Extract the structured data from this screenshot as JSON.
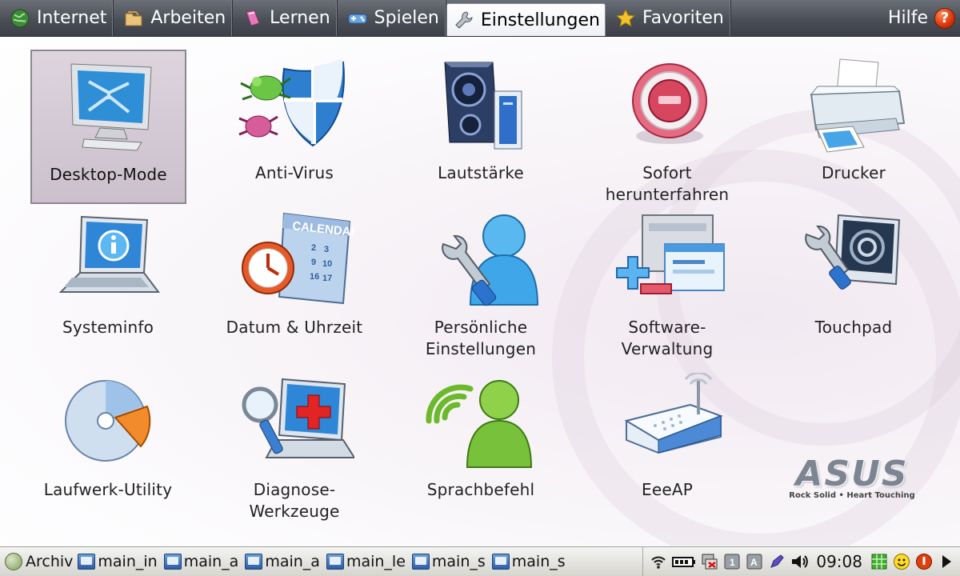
{
  "tabs": [
    {
      "name": "tab-internet",
      "icon": "globe-icon",
      "label": "Internet"
    },
    {
      "name": "tab-arbeiten",
      "icon": "folder-icon",
      "label": "Arbeiten"
    },
    {
      "name": "tab-lernen",
      "icon": "book-icon",
      "label": "Lernen"
    },
    {
      "name": "tab-spielen",
      "icon": "gamepad-icon",
      "label": "Spielen"
    },
    {
      "name": "tab-einstellungen",
      "icon": "wrench-icon",
      "label": "Einstellungen",
      "active": true
    },
    {
      "name": "tab-favoriten",
      "icon": "star-icon",
      "label": "Favoriten"
    }
  ],
  "help": {
    "label": "Hilfe",
    "icon": "help-icon",
    "glyph": "?"
  },
  "items": [
    {
      "name": "desktop-mode",
      "icon": "monitor-icon",
      "label": "Desktop-Mode",
      "selected": true
    },
    {
      "name": "anti-virus",
      "icon": "shield-bug-icon",
      "label": "Anti-Virus"
    },
    {
      "name": "lautstaerke",
      "icon": "speaker-icon",
      "label": "Lautstärke"
    },
    {
      "name": "sofort-herunterfahren",
      "icon": "power-button-icon",
      "label_lines": [
        "Sofort",
        "herunterfahren"
      ]
    },
    {
      "name": "drucker",
      "icon": "printer-icon",
      "label": "Drucker"
    },
    {
      "name": "systeminfo",
      "icon": "laptop-info-icon",
      "label": "Systeminfo"
    },
    {
      "name": "datum-uhrzeit",
      "icon": "calendar-clock-icon",
      "label": "Datum & Uhrzeit",
      "calendar_text": "CALENDAR"
    },
    {
      "name": "persoenliche-einstellungen",
      "icon": "user-wrench-icon",
      "label_lines": [
        "Persönliche",
        "Einstellungen"
      ]
    },
    {
      "name": "software-verwaltung",
      "icon": "software-windows-icon",
      "label_lines": [
        "Software-",
        "Verwaltung"
      ]
    },
    {
      "name": "touchpad",
      "icon": "touchpad-icon",
      "label": "Touchpad"
    },
    {
      "name": "laufwerk-utility",
      "icon": "disk-pie-icon",
      "label": "Laufwerk-Utility"
    },
    {
      "name": "diagnose-werkzeuge",
      "icon": "diagnose-icon",
      "label_lines": [
        "Diagnose-",
        "Werkzeuge"
      ]
    },
    {
      "name": "sprachbefehl",
      "icon": "voice-user-icon",
      "label": "Sprachbefehl"
    },
    {
      "name": "eeeap",
      "icon": "router-icon",
      "label": "EeeAP"
    }
  ],
  "logo": {
    "word": "ASUS",
    "tagline": "Rock Solid • Heart Touching"
  },
  "taskbar": {
    "start_label": "Archiv",
    "tasks": [
      "main_in",
      "main_a",
      "main_a",
      "main_le",
      "main_s",
      "main_s"
    ],
    "tray_icons": [
      "wifi-icon",
      "battery-icon",
      "network-icon",
      "keyboard-1-icon",
      "keyboard-a-icon",
      "pen-icon",
      "volume-icon"
    ],
    "clock": "09:08",
    "tray_right_icons": [
      "grid-icon",
      "smiley-icon",
      "shutdown-icon",
      "arrow-right-icon"
    ]
  },
  "colors": {
    "tab_bar": "#4a4e57",
    "accent_blue": "#2b6fcf",
    "help_red": "#d9340b"
  }
}
